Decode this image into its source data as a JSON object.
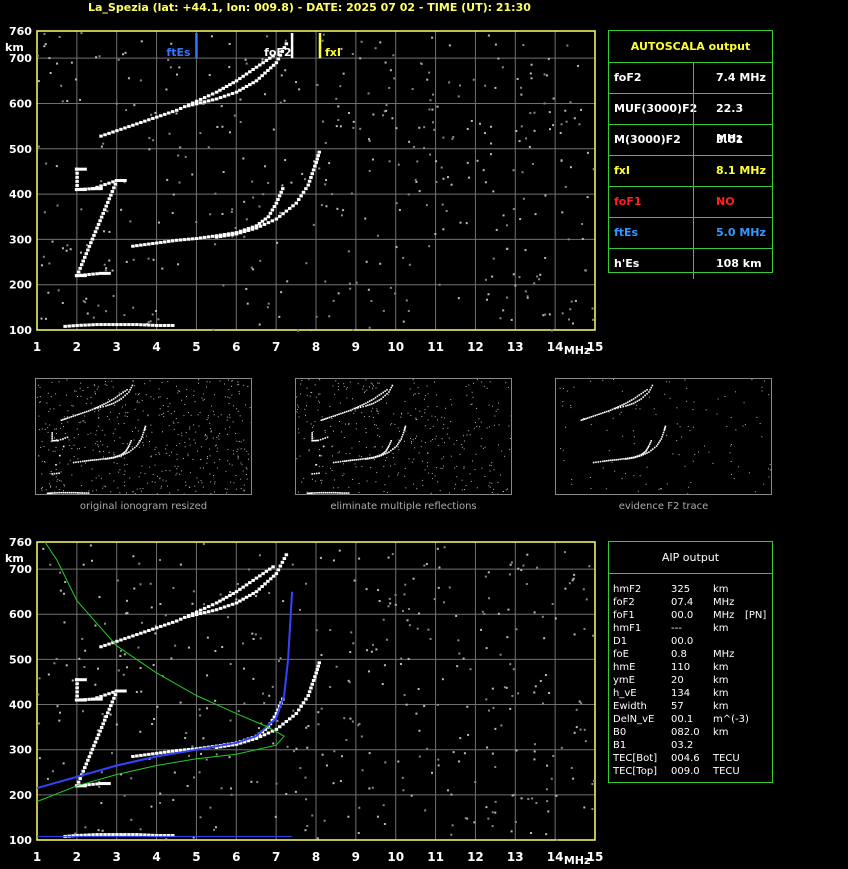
{
  "header": {
    "title": "La_Spezia (lat: +44.1, lon: 009.8) - DATE: 2025 07 02 - TIME (UT): 21:30"
  },
  "axes": {
    "y_unit": "km",
    "x_unit": "MHz",
    "y_ticks": [
      "100",
      "200",
      "300",
      "400",
      "500",
      "600",
      "700",
      "760"
    ],
    "x_ticks": [
      "1",
      "2",
      "3",
      "4",
      "5",
      "6",
      "7",
      "8",
      "9",
      "10",
      "11",
      "12",
      "13",
      "14",
      "15"
    ],
    "x_range": [
      1,
      15
    ],
    "y_range": [
      100,
      760
    ]
  },
  "markers": {
    "ftEs": "ftEs",
    "foF2": "foF2",
    "fxI": "fxI"
  },
  "autoscala": {
    "title": "AUTOSCALA output",
    "rows": [
      {
        "label": "foF2",
        "value": "7.4 MHz",
        "color": "#ffffff"
      },
      {
        "label": "MUF(3000)F2",
        "value": "22.3 MHz",
        "color": "#ffffff"
      },
      {
        "label": "M(3000)F2",
        "value": "3.01",
        "color": "#ffffff"
      },
      {
        "label": "fxI",
        "value": "8.1 MHz",
        "color": "#ffff33"
      },
      {
        "label": "foF1",
        "value": "NO",
        "color": "#ff2020"
      },
      {
        "label": "ftEs",
        "value": "5.0 MHz",
        "color": "#3399ff"
      },
      {
        "label": "h'Es",
        "value": "108     km",
        "color": "#ffffff"
      }
    ]
  },
  "thumbnails": [
    {
      "caption": "original ionogram resized"
    },
    {
      "caption": "eliminate multiple reflections"
    },
    {
      "caption": "evidence F2 trace"
    }
  ],
  "aip": {
    "title": "AIP output",
    "rows": [
      {
        "k": "hmF2",
        "v": "325",
        "u": "km",
        "x": ""
      },
      {
        "k": "foF2",
        "v": "07.4",
        "u": "MHz",
        "x": ""
      },
      {
        "k": "foF1",
        "v": "00.0",
        "u": "MHz",
        "x": "[PN]"
      },
      {
        "k": "hmF1",
        "v": "---",
        "u": "km",
        "x": ""
      },
      {
        "k": "D1",
        "v": "00.0",
        "u": "",
        "x": ""
      },
      {
        "k": "foE",
        "v": "0.8",
        "u": "MHz",
        "x": ""
      },
      {
        "k": "hmE",
        "v": "110",
        "u": "km",
        "x": ""
      },
      {
        "k": "ymE",
        "v": "20",
        "u": "km",
        "x": ""
      },
      {
        "k": "h_vE",
        "v": "134",
        "u": "km",
        "x": ""
      },
      {
        "k": "Ewidth",
        "v": "57",
        "u": "km",
        "x": ""
      },
      {
        "k": "DelN_vE",
        "v": "00.1",
        "u": "m^(-3)",
        "x": ""
      },
      {
        "k": "B0",
        "v": "082.0",
        "u": "km",
        "x": ""
      },
      {
        "k": "B1",
        "v": "03.2",
        "u": "",
        "x": ""
      },
      {
        "k": "TEC[Bot]",
        "v": "004.6",
        "u": "TECU",
        "x": ""
      },
      {
        "k": "TEC[Top]",
        "v": "009.0",
        "u": "TECU",
        "x": ""
      }
    ]
  },
  "chart_data": {
    "type": "scatter",
    "xlabel": "MHz",
    "ylabel": "km",
    "xlim": [
      1,
      15
    ],
    "ylim": [
      100,
      760
    ],
    "grid": true,
    "traces": [
      {
        "name": "E layer echo",
        "points": [
          [
            1.7,
            108
          ],
          [
            2.0,
            110
          ],
          [
            2.5,
            112
          ],
          [
            3.0,
            112
          ],
          [
            3.5,
            112
          ],
          [
            4.0,
            110
          ],
          [
            4.5,
            110
          ]
        ]
      },
      {
        "name": "F2 ordinary",
        "points": [
          [
            3.4,
            285
          ],
          [
            4.0,
            292
          ],
          [
            4.5,
            298
          ],
          [
            5.0,
            302
          ],
          [
            5.5,
            308
          ],
          [
            6.0,
            315
          ],
          [
            6.5,
            330
          ],
          [
            6.8,
            350
          ],
          [
            7.0,
            380
          ],
          [
            7.2,
            420
          ]
        ]
      },
      {
        "name": "F2 extraordinary",
        "points": [
          [
            5.5,
            305
          ],
          [
            6.0,
            312
          ],
          [
            6.5,
            325
          ],
          [
            7.0,
            345
          ],
          [
            7.5,
            380
          ],
          [
            7.8,
            420
          ],
          [
            8.0,
            470
          ],
          [
            8.1,
            500
          ]
        ]
      },
      {
        "name": "F2 second hop",
        "points": [
          [
            2.6,
            528
          ],
          [
            3.0,
            540
          ],
          [
            3.5,
            555
          ],
          [
            4.0,
            570
          ],
          [
            4.5,
            585
          ],
          [
            5.0,
            605
          ],
          [
            5.5,
            625
          ],
          [
            6.0,
            650
          ],
          [
            6.5,
            680
          ],
          [
            7.0,
            710
          ]
        ]
      },
      {
        "name": "F2 second hop x",
        "points": [
          [
            4.8,
            595
          ],
          [
            5.5,
            610
          ],
          [
            6.0,
            625
          ],
          [
            6.5,
            650
          ],
          [
            7.0,
            690
          ],
          [
            7.3,
            740
          ]
        ]
      },
      {
        "name": "small echoes",
        "points": [
          [
            2.0,
            455
          ],
          [
            2.0,
            410
          ],
          [
            2.4,
            412
          ],
          [
            3.0,
            430
          ],
          [
            2.0,
            220
          ],
          [
            2.6,
            225
          ]
        ]
      }
    ],
    "profile": [
      [
        1.0,
        215
      ],
      [
        2.0,
        240
      ],
      [
        3.0,
        265
      ],
      [
        4.0,
        285
      ],
      [
        5.0,
        300
      ],
      [
        6.0,
        315
      ],
      [
        6.5,
        330
      ],
      [
        7.0,
        370
      ],
      [
        7.2,
        420
      ],
      [
        7.3,
        500
      ],
      [
        7.4,
        650
      ]
    ],
    "model_curve": [
      [
        1.2,
        760
      ],
      [
        1.5,
        720
      ],
      [
        2.0,
        630
      ],
      [
        3.0,
        530
      ],
      [
        4.0,
        470
      ],
      [
        5.0,
        420
      ],
      [
        6.0,
        380
      ],
      [
        6.8,
        350
      ],
      [
        7.2,
        330
      ],
      [
        7.0,
        310
      ],
      [
        6.0,
        290
      ],
      [
        5.0,
        280
      ],
      [
        4.0,
        265
      ],
      [
        3.0,
        245
      ],
      [
        2.0,
        220
      ],
      [
        1.0,
        185
      ]
    ]
  }
}
